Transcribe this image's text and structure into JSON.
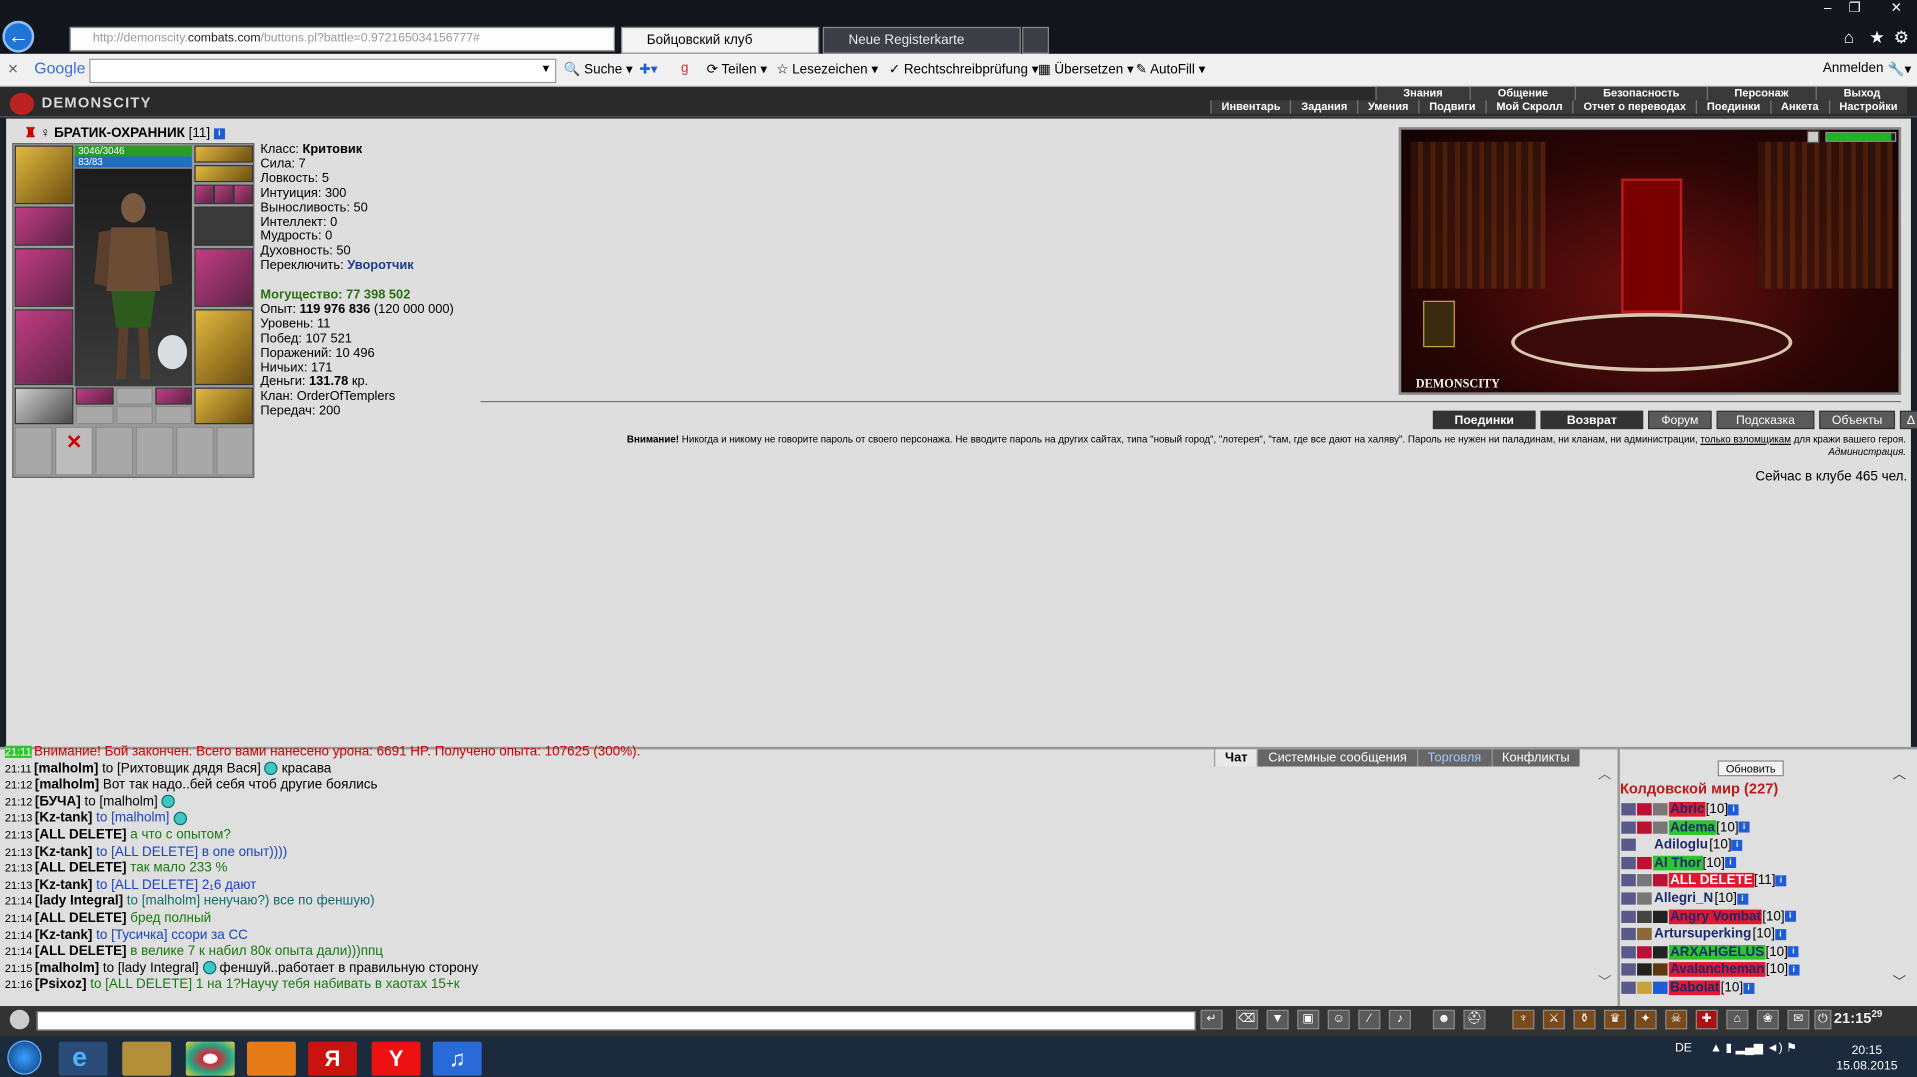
{
  "browser": {
    "url_dim": "http://demonscity.",
    "url_host": "combats.com",
    "url_rest": "/buttons.pl?battle=0.972165034156777#",
    "tabs": [
      "Бойцовский клуб",
      "Neue Registerkarte"
    ]
  },
  "google_toolbar": {
    "brand": "Google",
    "items": [
      "Suche",
      "Teilen",
      "Lesezeichen",
      "Rechtschreibprüfung",
      "Übersetzen",
      "AutoFill"
    ],
    "signin": "Anmelden"
  },
  "game_menu": {
    "logo": "DEMONSCITY",
    "top_row": [
      "Знания",
      "Общение",
      "Безопасность",
      "Персонаж",
      "Выход"
    ],
    "bottom_row": [
      "Инвентарь",
      "Задания",
      "Умения",
      "Подвиги",
      "Мой Скролл",
      "Отчет о переводах",
      "Поединки",
      "Анкета",
      "Настройки"
    ]
  },
  "character": {
    "name": "БРАТИК-ОХРАННИК",
    "level": "[11]",
    "hp": "3046/3046",
    "mp": "83/83",
    "stats": [
      {
        "label": "Класс:",
        "value": "Критовик"
      },
      {
        "label": "Сила:",
        "value": "7"
      },
      {
        "label": "Ловкость:",
        "value": "5"
      },
      {
        "label": "Интуиция:",
        "value": "300"
      },
      {
        "label": "Выносливость:",
        "value": "50"
      },
      {
        "label": "Интеллект:",
        "value": "0"
      },
      {
        "label": "Мудрость:",
        "value": "0"
      },
      {
        "label": "Духовность:",
        "value": "50"
      },
      {
        "label": "Переключить:",
        "value": "Уворотчик"
      }
    ],
    "power_label": "Могущество:",
    "power": "77 398 502",
    "exp_label": "Опыт:",
    "exp": "119 976 836",
    "exp_next": "(120 000 000)",
    "info": [
      {
        "label": "Уровень:",
        "value": "11"
      },
      {
        "label": "Побед:",
        "value": "107 521"
      },
      {
        "label": "Поражений:",
        "value": "10 496"
      },
      {
        "label": "Ничьих:",
        "value": "171"
      }
    ],
    "money_label": "Деньги:",
    "money": "131.78",
    "money_unit": "кр.",
    "clan_label": "Клан:",
    "clan": "OrderOfTemplers",
    "transfers_label": "Передач:",
    "transfers": "200"
  },
  "scene": {
    "label": "DEMONSCITY"
  },
  "nav_buttons": [
    "Поединки",
    "Возврат",
    "Форум",
    "Подсказка",
    "Объекты",
    "Δ"
  ],
  "warning": {
    "title": "Внимание!",
    "text": "Никогда и никому не говорите пароль от своего персонажа. Не вводите пароль на других сайтах, типа \"новый город\", \"лотерея\", \"там, где все дают на халяву\". Пароль не нужен ни паладинам, ни кланам, ни администрации,",
    "link": "только взломщикам",
    "tail": "для кражи вашего героя.",
    "sign": "Администрация."
  },
  "online": "Сейчас в клубе 465 чел.",
  "chat": {
    "tabs": [
      "Чат",
      "Системные сообщения",
      "Торговля",
      "Конфликты"
    ],
    "lines": [
      {
        "time": "21:11",
        "nick": "",
        "to": "",
        "text": "Внимание! Бой закончен. Всего вами нанесено урона: 6691 HP. Получено опыта: 107625 (300%).",
        "cls": "msg-red",
        "smile": false
      },
      {
        "time": "21:11",
        "nick": "[malholm]",
        "to": "to [Рихтовщик дядя Вася]",
        "text": "красава",
        "cls": "",
        "smile": true
      },
      {
        "time": "21:12",
        "nick": "[malholm]",
        "to": "",
        "text": "Вот так надо..бей себя чтоб другие боялись",
        "cls": "",
        "smile": false
      },
      {
        "time": "21:12",
        "nick": "[БУЧА]",
        "to": "to [malholm]",
        "text": "",
        "cls": "",
        "smile": true
      },
      {
        "time": "21:13",
        "nick": "[Kz-tank]",
        "to": "to [malholm]",
        "text": "",
        "cls": "msg-blue",
        "smile": true
      },
      {
        "time": "21:13",
        "nick": "[ALL DELETE]",
        "to": "",
        "text": "а что с опытом?",
        "cls": "msg-green",
        "smile": false
      },
      {
        "time": "21:13",
        "nick": "[Kz-tank]",
        "to": "to [ALL DELETE]",
        "text": "в опе опыт))))",
        "cls": "msg-blue",
        "smile": false
      },
      {
        "time": "21:13",
        "nick": "[ALL DELETE]",
        "to": "",
        "text": "так мало 233 %",
        "cls": "msg-green",
        "smile": false
      },
      {
        "time": "21:13",
        "nick": "[Kz-tank]",
        "to": "to [ALL DELETE]",
        "text": "2₁6 дают",
        "cls": "msg-blue",
        "smile": false
      },
      {
        "time": "21:14",
        "nick": "[lady Integral]",
        "to": "to [malholm]",
        "text": "ненучаю?) все по феншую)",
        "cls": "msg-teal",
        "smile": false
      },
      {
        "time": "21:14",
        "nick": "[ALL DELETE]",
        "to": "",
        "text": "бред полный",
        "cls": "msg-green",
        "smile": false
      },
      {
        "time": "21:14",
        "nick": "[Kz-tank]",
        "to": "to [Тусичка]",
        "text": "ссори за СС",
        "cls": "msg-blue",
        "smile": false
      },
      {
        "time": "21:14",
        "nick": "[ALL DELETE]",
        "to": "",
        "text": "в велике 7 к набил 80к опыта дали)))ппц",
        "cls": "msg-green",
        "smile": false
      },
      {
        "time": "21:15",
        "nick": "[malholm]",
        "to": "to [lady Integral]",
        "text": "феншуй..работает в правильную сторону",
        "cls": "",
        "smile": true
      },
      {
        "time": "21:16",
        "nick": "[Psixoz]",
        "to": "to [ALL DELETE]",
        "text": "1 на 1?Научу тебя набивать в хаотах 15+к",
        "cls": "msg-green",
        "smile": false
      }
    ]
  },
  "sidebar": {
    "refresh": "Обновить",
    "world": "Колдовской мир (227)",
    "users": [
      {
        "name": "Abric",
        "level": "[10]",
        "hl": "hl-r"
      },
      {
        "name": "Adema",
        "level": "[10]",
        "hl": "hl-g"
      },
      {
        "name": "Adiloglu",
        "level": "[10]",
        "hl": ""
      },
      {
        "name": "Al Thor",
        "level": "[10]",
        "hl": "hl-g"
      },
      {
        "name": "ALL DELETE",
        "level": "[11]",
        "hl": "hl-rr"
      },
      {
        "name": "Allegri_N",
        "level": "[10]",
        "hl": ""
      },
      {
        "name": "Angry Vombat",
        "level": "[10]",
        "hl": "hl-r"
      },
      {
        "name": "Artursuperking",
        "level": "[10]",
        "hl": ""
      },
      {
        "name": "ARXAHGELUS",
        "level": "[10]",
        "hl": "hl-g"
      },
      {
        "name": "Avalancheman",
        "level": "[10]",
        "hl": "hl-r"
      },
      {
        "name": "Babolat",
        "level": "[10]",
        "hl": "hl-r"
      }
    ]
  },
  "input_bar": {
    "clock": "21:15",
    "clock_sec": "29"
  },
  "taskbar": {
    "lang": "DE",
    "time": "20:15",
    "date": "15.08.2015"
  }
}
